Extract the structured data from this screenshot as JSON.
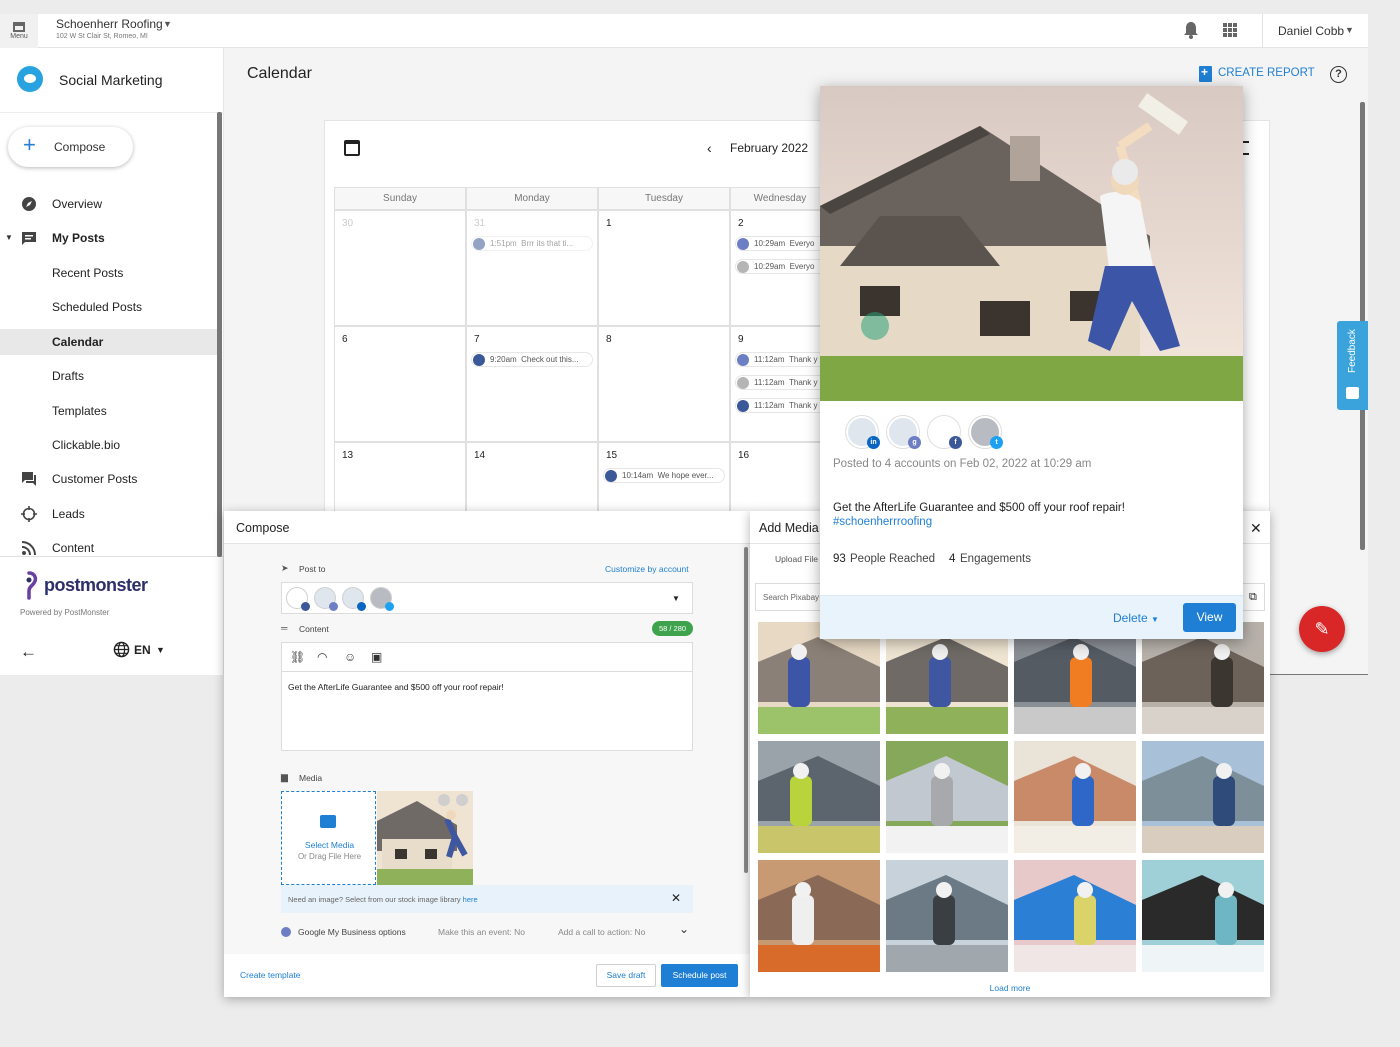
{
  "topbar": {
    "menu_label": "Menu",
    "account_name": "Schoenherr Roofing",
    "account_address": "102 W St Clair St, Romeo, MI",
    "user_name": "Daniel Cobb"
  },
  "sidebar": {
    "app_name": "Social Marketing",
    "compose_label": "Compose",
    "items": [
      {
        "label": "Overview",
        "icon": "compass-icon"
      },
      {
        "label": "My Posts",
        "icon": "posts-icon"
      },
      {
        "label": "Recent Posts"
      },
      {
        "label": "Scheduled Posts"
      },
      {
        "label": "Calendar",
        "active": true
      },
      {
        "label": "Drafts"
      },
      {
        "label": "Templates"
      },
      {
        "label": "Clickable.bio"
      },
      {
        "label": "Customer Posts",
        "icon": "chat-icon"
      },
      {
        "label": "Leads",
        "icon": "crosshair-icon"
      },
      {
        "label": "Content",
        "icon": "rss-icon"
      }
    ],
    "brand_name": "postmonster",
    "powered_by": "Powered by PostMonster",
    "language": "EN"
  },
  "main": {
    "title": "Calendar",
    "create_report": "CREATE REPORT",
    "feedback": "Feedback"
  },
  "calendar": {
    "month": "February 2022",
    "weekdays": [
      "Sunday",
      "Monday",
      "Tuesday",
      "Wednesday"
    ],
    "rows": [
      [
        {
          "day": "30",
          "muted": true,
          "events": []
        },
        {
          "day": "31",
          "muted": true,
          "events": [
            {
              "time": "1:51pm",
              "text": "Brrr its that ti...",
              "net": "facebook",
              "faded": true
            }
          ]
        },
        {
          "day": "1",
          "events": []
        },
        {
          "day": "2",
          "events": [
            {
              "time": "10:29am",
              "text": "Everyo",
              "net": "gmb"
            },
            {
              "time": "10:29am",
              "text": "Everyo",
              "net": "count"
            }
          ]
        }
      ],
      [
        {
          "day": "6",
          "events": []
        },
        {
          "day": "7",
          "events": [
            {
              "time": "9:20am",
              "text": "Check out this...",
              "net": "facebook"
            }
          ]
        },
        {
          "day": "8",
          "events": []
        },
        {
          "day": "9",
          "events": [
            {
              "time": "11:12am",
              "text": "Thank y",
              "net": "gmb"
            },
            {
              "time": "11:12am",
              "text": "Thank y",
              "net": "count"
            },
            {
              "time": "11:12am",
              "text": "Thank y",
              "net": "facebook"
            }
          ]
        }
      ],
      [
        {
          "day": "13",
          "events": []
        },
        {
          "day": "14",
          "events": []
        },
        {
          "day": "15",
          "events": [
            {
              "time": "10:14am",
              "text": "We hope ever...",
              "net": "facebook"
            }
          ]
        },
        {
          "day": "16",
          "events": []
        }
      ]
    ]
  },
  "preview": {
    "meta": "Posted to 4 accounts on Feb 02, 2022 at 10:29 am",
    "text": "Get the AfterLife Guarantee and $500 off your roof repair!",
    "hashtag": "#schoenherrroofing",
    "reach_num": "93",
    "reach_label": "People Reached",
    "engage_num": "4",
    "engage_label": "Engagements",
    "delete_label": "Delete",
    "view_label": "View"
  },
  "compose": {
    "title": "Compose",
    "post_to_label": "Post to",
    "customize_label": "Customize by account",
    "content_label": "Content",
    "char_count": "58 / 280",
    "content_text": "Get the AfterLife Guarantee and $500 off your roof repair!",
    "media_label": "Media",
    "select_media": "Select Media",
    "drag_file": "Or Drag File Here",
    "stock_text": "Need an image? Select from our stock image library ",
    "stock_link": "here",
    "gmb_label": "Google My Business options",
    "gmb_event": "Make this an event: No",
    "gmb_cta": "Add a call to action: No",
    "create_template": "Create template",
    "save_draft": "Save draft",
    "schedule_post": "Schedule post"
  },
  "media": {
    "title": "Add Media",
    "upload_tab": "Upload File",
    "search_placeholder": "Search Pixabay",
    "load_more": "Load more"
  },
  "colors": {
    "accent": "#1f7fd4",
    "facebook": "#3b5998",
    "linkedin": "#0a66c2",
    "twitter": "#1da1f2",
    "gmb": "#6d7fc4",
    "fab": "#d92626",
    "count_badge": "#3fa34d"
  }
}
